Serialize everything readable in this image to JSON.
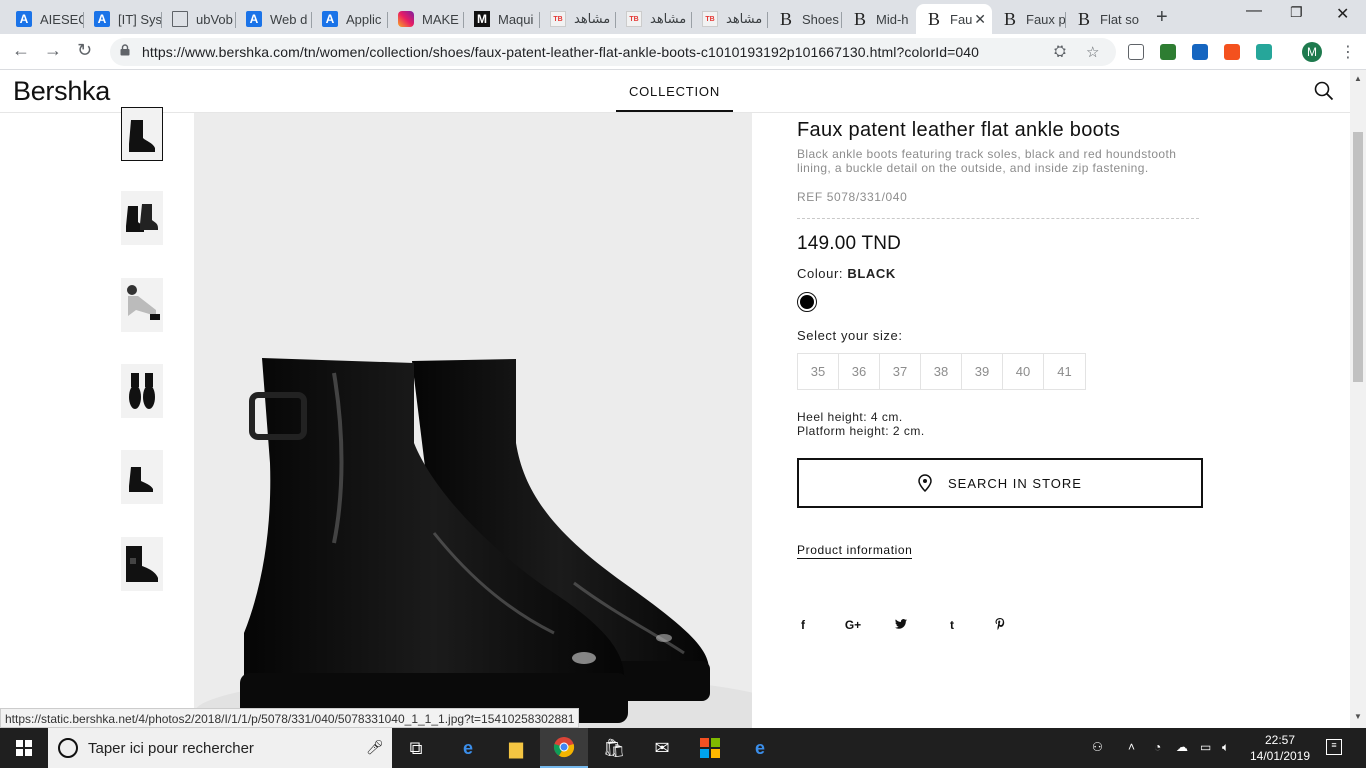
{
  "browser": {
    "tabs": [
      {
        "label": "AIESEC",
        "icon": "aiesec-icon",
        "fav": "A"
      },
      {
        "label": "[IT] Sys",
        "icon": "aiesec-icon",
        "fav": "A"
      },
      {
        "label": "ubVob",
        "icon": "document-icon",
        "fav": ""
      },
      {
        "label": "Web d",
        "icon": "aiesec-icon",
        "fav": "A"
      },
      {
        "label": "Applic",
        "icon": "aiesec-icon",
        "fav": "A"
      },
      {
        "label": "MAKE",
        "icon": "instagram-icon",
        "fav": ""
      },
      {
        "label": "Maqui",
        "icon": "m-logo-icon",
        "fav": "M"
      },
      {
        "label": "مشاهد",
        "icon": "site-image-icon",
        "fav": "TripBoss"
      },
      {
        "label": "مشاهد",
        "icon": "site-image-icon",
        "fav": "TripBoss"
      },
      {
        "label": "مشاهد",
        "icon": "site-image-icon",
        "fav": "TripBoss"
      },
      {
        "label": "Shoes",
        "icon": "bershka-b-icon",
        "fav": "B"
      },
      {
        "label": "Mid-h",
        "icon": "bershka-b-icon",
        "fav": "B"
      },
      {
        "label": "Fau",
        "icon": "bershka-b-icon",
        "fav": "B",
        "active": true
      },
      {
        "label": "Faux p",
        "icon": "bershka-b-icon",
        "fav": "B"
      },
      {
        "label": "Flat so",
        "icon": "bershka-b-icon",
        "fav": "B"
      }
    ],
    "url": "https://www.bershka.com/tn/women/collection/shoes/faux-patent-leather-flat-ankle-boots-c1010193192p101667130.html?colorId=040",
    "profile_initial": "M",
    "status_url": "https://static.bershka.net/4/photos2/2018/I/1/1/p/5078/331/040/5078331040_1_1_1.jpg?t=1541025830288",
    "status_url_visible": "https://static.bershka.net/4/photos2/2018/I/1/1/p/5078/331/040/5078331040_1_1_1.jpg?t=15410258302881"
  },
  "site": {
    "logo": "Bershka",
    "nav_collection": "COLLECTION"
  },
  "product": {
    "title": "Faux patent leather flat ankle boots",
    "description": "Black ankle boots featuring track soles, black and red houndstooth lining, a buckle detail on the outside, and inside zip fastening.",
    "ref": "REF 5078/331/040",
    "price": "149.00 TND",
    "colour_label": "Colour:",
    "colour_value": "BLACK",
    "size_label": "Select your size:",
    "sizes": [
      "35",
      "36",
      "37",
      "38",
      "39",
      "40",
      "41"
    ],
    "heel_height": "Heel height: 4 cm.",
    "platform_height": "Platform height: 2 cm.",
    "store_button": "SEARCH IN STORE",
    "product_info_link": "Product information",
    "social": [
      "f",
      "G+",
      "twitter",
      "t",
      "pinterest"
    ]
  },
  "taskbar": {
    "search_placeholder": "Taper ici pour rechercher",
    "time": "22:57",
    "date": "14/01/2019"
  },
  "colors": {
    "accent": "#111111",
    "muted_text": "#8d8d8d",
    "taskbar_bg": "#1f1f1f"
  }
}
